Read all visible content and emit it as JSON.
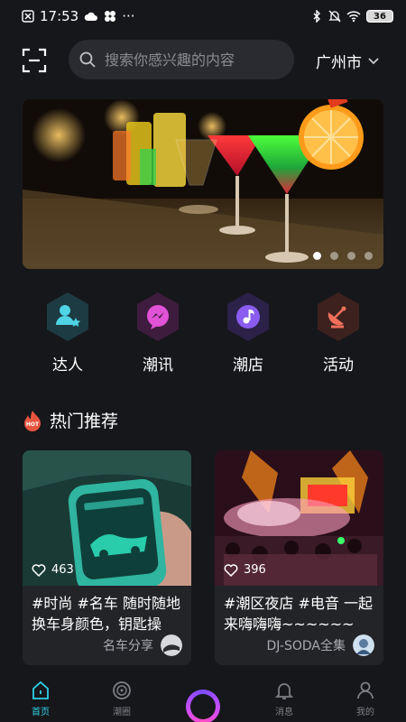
{
  "status_bar": {
    "time": "17:53",
    "more": "···",
    "battery": "36"
  },
  "search": {
    "placeholder": "搜索你感兴趣的内容"
  },
  "city": {
    "label": "广州市"
  },
  "banner": {
    "dot_count": 4,
    "active_index": 0
  },
  "categories": [
    {
      "label": "达人",
      "icon": "expert-person-icon",
      "color": "#4fd4e6"
    },
    {
      "label": "潮讯",
      "icon": "messenger-icon",
      "color": "#e052d6"
    },
    {
      "label": "潮店",
      "icon": "music-note-icon",
      "color": "#8a5cf0"
    },
    {
      "label": "活动",
      "icon": "satellite-dish-icon",
      "color": "#f2705a"
    }
  ],
  "section": {
    "title": "热门推荐",
    "badge": "HOT"
  },
  "cards": [
    {
      "likes": "463",
      "text": "#时尚 #名车 随时随地换车身颜色，钥匙操",
      "author": "名车分享"
    },
    {
      "likes": "396",
      "text": "#潮区夜店 #电音 一起来嗨嗨嗨~~~~~~",
      "author": "DJ-SODA全集"
    }
  ],
  "nav": [
    {
      "label": "首页",
      "icon": "home-icon",
      "active": true
    },
    {
      "label": "潮圈",
      "icon": "circle-icon",
      "active": false
    },
    {
      "label": "",
      "icon": "center-ring-icon",
      "active": false
    },
    {
      "label": "消息",
      "icon": "bell-icon",
      "active": false
    },
    {
      "label": "我的",
      "icon": "profile-icon",
      "active": false
    }
  ],
  "colors": {
    "accent": "#2ed0e6",
    "background": "#16171b",
    "card": "#232428"
  }
}
